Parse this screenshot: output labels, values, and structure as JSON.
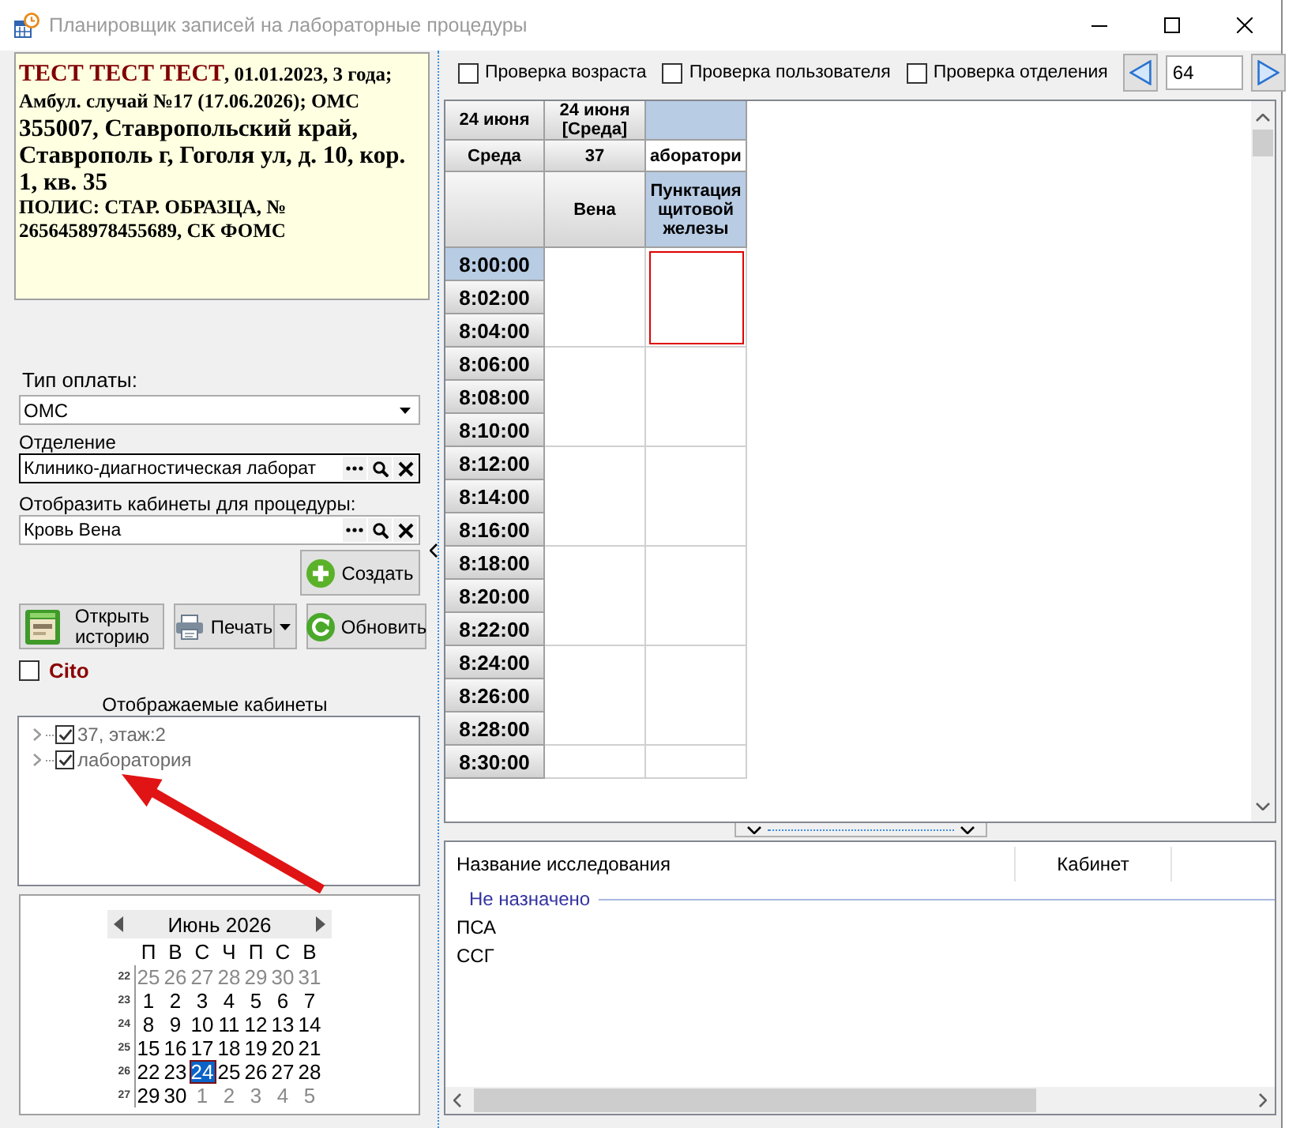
{
  "window": {
    "title": "Планировщик записей на лабораторные процедуры"
  },
  "patient": {
    "name": "ТЕСТ ТЕСТ ТЕСТ",
    "birth_info": ", 01.01.2023, 3 года;",
    "case": "Амбул. случай №17 (17.06.2026); ОМС",
    "address": "355007, Ставропольский край, Ставрополь г, Гоголя ул, д. 10, кор. 1, кв. 35",
    "policy": "ПОЛИС: СТАР. ОБРАЗЦА, № 2656458978455689, СК ФОМС"
  },
  "payment": {
    "label": "Тип оплаты:",
    "value": "ОМС"
  },
  "department": {
    "label": "Отделение",
    "value": "Клинико-диагностическая лаборат",
    "focused": true
  },
  "procedure": {
    "label": "Отобразить кабинеты для процедуры:",
    "value": "Кровь Вена",
    "focused": false
  },
  "create": {
    "label": "Создать"
  },
  "actions": [
    {
      "kind": "history",
      "label": "Открыть историю"
    },
    {
      "kind": "print",
      "label": "Печать"
    },
    {
      "kind": "refresh",
      "label": "Обновить"
    }
  ],
  "cito": {
    "label": "Cito",
    "checked": false
  },
  "cabinets": {
    "title": "Отображаемые кабинеты",
    "items": [
      {
        "label": "37, этаж:2",
        "checked": true,
        "expanded": false
      },
      {
        "label": "лаборатория",
        "checked": true,
        "expanded": false
      }
    ]
  },
  "calendar": {
    "month": "Июнь 2026",
    "weekdays": [
      "П",
      "В",
      "С",
      "Ч",
      "П",
      "С",
      "В"
    ],
    "weeks": [
      {
        "number": "22",
        "days": [
          {
            "label": "25",
            "other_month": true,
            "selected": false
          },
          {
            "label": "26",
            "other_month": true,
            "selected": false
          },
          {
            "label": "27",
            "other_month": true,
            "selected": false
          },
          {
            "label": "28",
            "other_month": true,
            "selected": false
          },
          {
            "label": "29",
            "other_month": true,
            "selected": false
          },
          {
            "label": "30",
            "other_month": true,
            "selected": false
          },
          {
            "label": "31",
            "other_month": true,
            "selected": false
          }
        ]
      },
      {
        "number": "23",
        "days": [
          {
            "label": "1",
            "other_month": false,
            "selected": false
          },
          {
            "label": "2",
            "other_month": false,
            "selected": false
          },
          {
            "label": "3",
            "other_month": false,
            "selected": false
          },
          {
            "label": "4",
            "other_month": false,
            "selected": false
          },
          {
            "label": "5",
            "other_month": false,
            "selected": false
          },
          {
            "label": "6",
            "other_month": false,
            "selected": false
          },
          {
            "label": "7",
            "other_month": false,
            "selected": false
          }
        ]
      },
      {
        "number": "24",
        "days": [
          {
            "label": "8",
            "other_month": false,
            "selected": false
          },
          {
            "label": "9",
            "other_month": false,
            "selected": false
          },
          {
            "label": "10",
            "other_month": false,
            "selected": false
          },
          {
            "label": "11",
            "other_month": false,
            "selected": false
          },
          {
            "label": "12",
            "other_month": false,
            "selected": false
          },
          {
            "label": "13",
            "other_month": false,
            "selected": false
          },
          {
            "label": "14",
            "other_month": false,
            "selected": false
          }
        ]
      },
      {
        "number": "25",
        "days": [
          {
            "label": "15",
            "other_month": false,
            "selected": false
          },
          {
            "label": "16",
            "other_month": false,
            "selected": false
          },
          {
            "label": "17",
            "other_month": false,
            "selected": false
          },
          {
            "label": "18",
            "other_month": false,
            "selected": false
          },
          {
            "label": "19",
            "other_month": false,
            "selected": false
          },
          {
            "label": "20",
            "other_month": false,
            "selected": false
          },
          {
            "label": "21",
            "other_month": false,
            "selected": false
          }
        ]
      },
      {
        "number": "26",
        "days": [
          {
            "label": "22",
            "other_month": false,
            "selected": false
          },
          {
            "label": "23",
            "other_month": false,
            "selected": false
          },
          {
            "label": "24",
            "other_month": false,
            "selected": true
          },
          {
            "label": "25",
            "other_month": false,
            "selected": false
          },
          {
            "label": "26",
            "other_month": false,
            "selected": false
          },
          {
            "label": "27",
            "other_month": false,
            "selected": false
          },
          {
            "label": "28",
            "other_month": false,
            "selected": false
          }
        ]
      },
      {
        "number": "27",
        "days": [
          {
            "label": "29",
            "other_month": false,
            "selected": false
          },
          {
            "label": "30",
            "other_month": false,
            "selected": false
          },
          {
            "label": "1",
            "other_month": true,
            "selected": false
          },
          {
            "label": "2",
            "other_month": true,
            "selected": false
          },
          {
            "label": "3",
            "other_month": true,
            "selected": false
          },
          {
            "label": "4",
            "other_month": true,
            "selected": false
          },
          {
            "label": "5",
            "other_month": true,
            "selected": false
          }
        ]
      }
    ]
  },
  "toolbar": {
    "checks": [
      {
        "label": "Проверка возраста",
        "checked": false
      },
      {
        "label": "Проверка пользователя",
        "checked": false
      },
      {
        "label": "Проверка отделения",
        "checked": false
      }
    ],
    "page": "64"
  },
  "schedule": {
    "time_header": {
      "date": "24 июня",
      "weekday": "Среда"
    },
    "columns": [
      {
        "date": "24 июня [Среда]",
        "room": "37",
        "procedure": "Вена",
        "selected": false,
        "slots": [
          {
            "selected": false
          },
          {
            "selected": false
          },
          {
            "selected": false
          },
          {
            "selected": false
          },
          {
            "selected": false
          },
          {
            "selected": false
          }
        ]
      },
      {
        "room": "аборатори",
        "procedure": "Пунктация щитовой железы",
        "selected": true,
        "slots": [
          {
            "selected": true
          },
          {
            "selected": false
          },
          {
            "selected": false
          },
          {
            "selected": false
          },
          {
            "selected": false
          },
          {
            "selected": false
          }
        ]
      }
    ],
    "times": [
      {
        "label": "8:00:00",
        "selected": true
      },
      {
        "label": "8:02:00",
        "selected": false
      },
      {
        "label": "8:04:00",
        "selected": false
      },
      {
        "label": "8:06:00",
        "selected": false
      },
      {
        "label": "8:08:00",
        "selected": false
      },
      {
        "label": "8:10:00",
        "selected": false
      },
      {
        "label": "8:12:00",
        "selected": false
      },
      {
        "label": "8:14:00",
        "selected": false
      },
      {
        "label": "8:16:00",
        "selected": false
      },
      {
        "label": "8:18:00",
        "selected": false
      },
      {
        "label": "8:20:00",
        "selected": false
      },
      {
        "label": "8:22:00",
        "selected": false
      },
      {
        "label": "8:24:00",
        "selected": false
      },
      {
        "label": "8:26:00",
        "selected": false
      },
      {
        "label": "8:28:00",
        "selected": false
      },
      {
        "label": "8:30:00",
        "selected": false
      }
    ]
  },
  "assignments": {
    "columns": [
      "Название исследования",
      "Кабинет"
    ],
    "groups": [
      {
        "title": "Не назначено",
        "rows": [
          "ПСА",
          "ССГ"
        ]
      }
    ]
  }
}
